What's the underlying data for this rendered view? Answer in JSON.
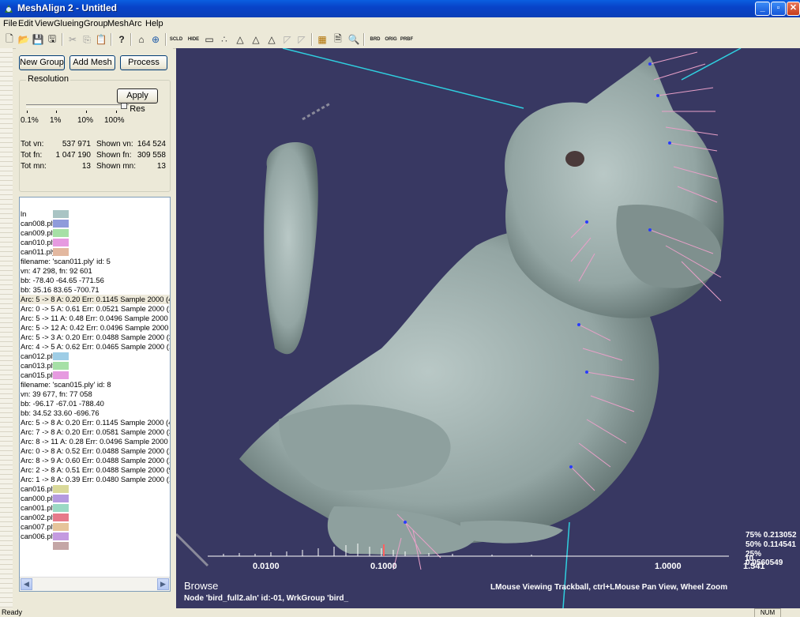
{
  "window": {
    "title": "MeshAlign 2 - Untitled",
    "minimize": "_",
    "maximize": "▫",
    "close": "✕"
  },
  "menu": [
    "File",
    "Edit",
    "View",
    "Glueing",
    "Group",
    "Mesh",
    "Arc",
    "Help"
  ],
  "toolbar": {
    "scld": "SCLD",
    "hide": "HIDE",
    "brd": "BRD",
    "orig": "ORIG",
    "prbf": "PRBF"
  },
  "panel": {
    "new_group": "New Group",
    "add_mesh": "Add Mesh",
    "process": "Process",
    "resolution_label": "Resolution",
    "apply_res": "Apply Res",
    "res_ticks": [
      "0.1%",
      "1%",
      "10%",
      "100%"
    ],
    "res_level_percent": 100,
    "stats": {
      "tot_vn_label": "Tot vn:",
      "tot_vn": "537 971",
      "shown_vn_label": "Shown vn:",
      "shown_vn": "164 524",
      "tot_fn_label": "Tot fn:",
      "tot_fn": "1 047 190",
      "shown_fn_label": "Shown fn:",
      "shown_fn": "309 558",
      "tot_mn_label": "Tot mn:",
      "tot_mn": "13",
      "shown_mn_label": "Shown mn:",
      "shown_mn": "13"
    }
  },
  "tree": [
    {
      "text": "ln",
      "color": "#a9c4c4"
    },
    {
      "text": "can008.ply",
      "color": "#8f9bdb"
    },
    {
      "text": "can009.ply",
      "color": "#a6e0a6"
    },
    {
      "text": "can010.ply",
      "color": "#e69ae0"
    },
    {
      "text": "can011.ply",
      "color": "#e3b8a0"
    },
    {
      "text": " filename: 'scan011.ply' id:  5"
    },
    {
      "text": " vn:  47 298, fn:  92 601"
    },
    {
      "text": " bb:  -78.40  -64.65 -771.56"
    },
    {
      "text": " bb:   35.16   83.65 -700.71"
    },
    {
      "text": "Arc:  5 ->  8 A: 0.20 Err:  0.1145 Sample 2000 (4",
      "selected": true
    },
    {
      "text": "Arc:  0 ->  5 A: 0.61 Err:  0.0521 Sample 2000 (1"
    },
    {
      "text": "Arc:  5 -> 11 A: 0.48 Err:  0.0496 Sample 2000 (8"
    },
    {
      "text": "Arc:  5 -> 12 A: 0.42 Err:  0.0496 Sample 2000 (8"
    },
    {
      "text": "Arc:  5 ->  3 A: 0.20 Err:  0.0488 Sample 2000 (3"
    },
    {
      "text": "Arc:  4 ->  5 A: 0.62 Err:  0.0465 Sample 2000 (1"
    },
    {
      "text": "can012.ply",
      "color": "#9ecde6"
    },
    {
      "text": "can013.ply",
      "color": "#a6e0a6"
    },
    {
      "text": "can015.ply",
      "color": "#e69ae0"
    },
    {
      "text": " filename: 'scan015.ply' id:  8"
    },
    {
      "text": " vn:  39 677, fn:  77 058"
    },
    {
      "text": " bb:  -96.17  -67.01 -788.40"
    },
    {
      "text": " bb:   34.52   33.60 -696.76"
    },
    {
      "text": "Arc:  5 ->  8 A: 0.20 Err:  0.1145 Sample 2000 (4"
    },
    {
      "text": "Arc:  7 ->  8 A: 0.20 Err:  0.0581 Sample 2000 (3"
    },
    {
      "text": "Arc:  8 -> 11 A: 0.28 Err:  0.0496 Sample 2000 (5"
    },
    {
      "text": "Arc:  0 ->  8 A: 0.52 Err:  0.0488 Sample 2000 (1"
    },
    {
      "text": "Arc:  8 ->  9 A: 0.60 Err:  0.0488 Sample 2000 (1"
    },
    {
      "text": "Arc:  2 ->  8 A: 0.51 Err:  0.0488 Sample 2000 (9"
    },
    {
      "text": "Arc:  1 ->  8 A: 0.39 Err:  0.0480 Sample 2000 (1"
    },
    {
      "text": "can016.ply",
      "color": "#d9d99a"
    },
    {
      "text": "can000.ply",
      "color": "#b49ae0"
    },
    {
      "text": "can001.ply",
      "color": "#9ad9c4"
    },
    {
      "text": "can002.ply",
      "color": "#e67a8a"
    },
    {
      "text": "can007.ply",
      "color": "#e6c49a"
    },
    {
      "text": "can006.ply",
      "color": "#c49ae0"
    },
    {
      "text": "",
      "color": "#c4a6a6"
    }
  ],
  "viewport": {
    "histo_ticks": [
      "0.0100",
      "0.1000",
      "1.0000",
      "10"
    ],
    "histo_max": "1.541",
    "percentiles": [
      "75% 0.213052",
      "50% 0.114541",
      "25% 0.0560549"
    ],
    "mode": "Browse",
    "node_info": "Node 'bird_full2.aln' id:-01, WrkGroup 'bird_",
    "help": "LMouse Viewing Trackball, ctrl+LMouse Pan View, Wheel Zoom"
  },
  "status": {
    "left": "Ready",
    "num": "NUM"
  }
}
